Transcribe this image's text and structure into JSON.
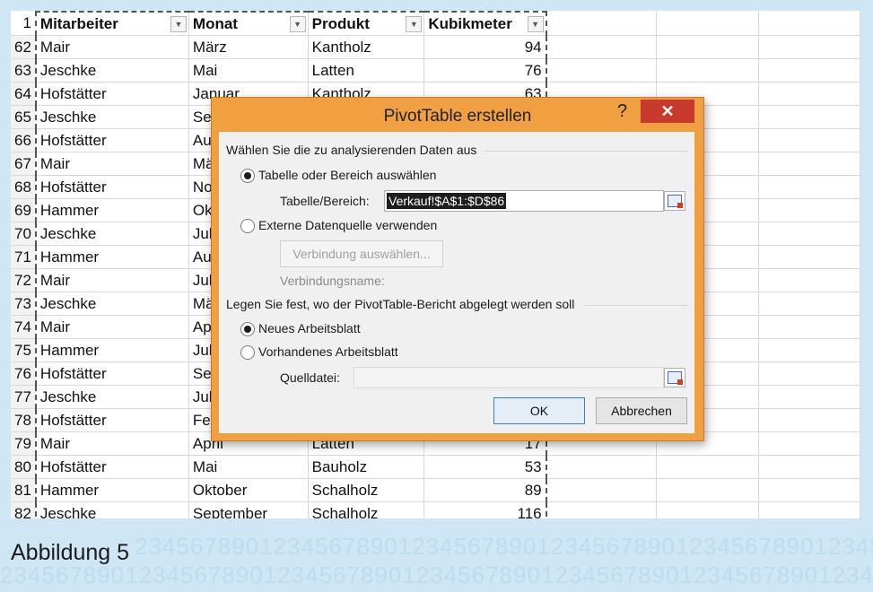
{
  "background_digits": "23456789012345678901234567890123456789012345678901234567890123456789",
  "sheet": {
    "headers": {
      "row": "1",
      "col1": "Mitarbeiter",
      "col2": "Monat",
      "col3": "Produkt",
      "col4": "Kubikmeter"
    },
    "rows": [
      {
        "n": "62",
        "a": "Mair",
        "b": "März",
        "c": "Kantholz",
        "d": "94"
      },
      {
        "n": "63",
        "a": "Jeschke",
        "b": "Mai",
        "c": "Latten",
        "d": "76"
      },
      {
        "n": "64",
        "a": "Hofstätter",
        "b": "Januar",
        "c": "Kantholz",
        "d": "63"
      },
      {
        "n": "65",
        "a": "Jeschke",
        "b": "Se",
        "c": "",
        "d": ""
      },
      {
        "n": "66",
        "a": "Hofstätter",
        "b": "Au",
        "c": "",
        "d": ""
      },
      {
        "n": "67",
        "a": "Mair",
        "b": "Mä",
        "c": "",
        "d": ""
      },
      {
        "n": "68",
        "a": "Hofstätter",
        "b": "No",
        "c": "",
        "d": ""
      },
      {
        "n": "69",
        "a": "Hammer",
        "b": "Ok",
        "c": "",
        "d": ""
      },
      {
        "n": "70",
        "a": "Jeschke",
        "b": "Jul",
        "c": "",
        "d": ""
      },
      {
        "n": "71",
        "a": "Hammer",
        "b": "Au",
        "c": "",
        "d": ""
      },
      {
        "n": "72",
        "a": "Mair",
        "b": "Jul",
        "c": "",
        "d": ""
      },
      {
        "n": "73",
        "a": "Jeschke",
        "b": "Mä",
        "c": "",
        "d": ""
      },
      {
        "n": "74",
        "a": "Mair",
        "b": "Ap",
        "c": "",
        "d": ""
      },
      {
        "n": "75",
        "a": "Hammer",
        "b": "Jul",
        "c": "",
        "d": ""
      },
      {
        "n": "76",
        "a": "Hofstätter",
        "b": "Se",
        "c": "",
        "d": ""
      },
      {
        "n": "77",
        "a": "Jeschke",
        "b": "Jul",
        "c": "",
        "d": ""
      },
      {
        "n": "78",
        "a": "Hofstätter",
        "b": "Fe",
        "c": "",
        "d": ""
      },
      {
        "n": "79",
        "a": "Mair",
        "b": "April",
        "c": "Latten",
        "d": "17"
      },
      {
        "n": "80",
        "a": "Hofstätter",
        "b": "Mai",
        "c": "Bauholz",
        "d": "53"
      },
      {
        "n": "81",
        "a": "Hammer",
        "b": "Oktober",
        "c": "Schalholz",
        "d": "89"
      },
      {
        "n": "82",
        "a": "Jeschke",
        "b": "September",
        "c": "Schalholz",
        "d": "116"
      }
    ]
  },
  "caption": "Abbildung 5",
  "dialog": {
    "title": "PivotTable erstellen",
    "help": "?",
    "close": "✕",
    "section1": "Wählen Sie die zu analysierenden Daten aus",
    "opt_table": "Tabelle oder Bereich auswählen",
    "range_label": "Tabelle/Bereich:",
    "range_value": "Verkauf!$A$1:$D$86",
    "opt_external": "Externe Datenquelle verwenden",
    "connection_button": "Verbindung auswählen...",
    "connection_name": "Verbindungsname:",
    "section2": "Legen Sie fest, wo der PivotTable-Bericht abgelegt werden soll",
    "opt_new": "Neues Arbeitsblatt",
    "opt_existing": "Vorhandenes Arbeitsblatt",
    "source_label": "Quelldatei:",
    "source_value": "",
    "ok": "OK",
    "cancel": "Abbrechen"
  }
}
